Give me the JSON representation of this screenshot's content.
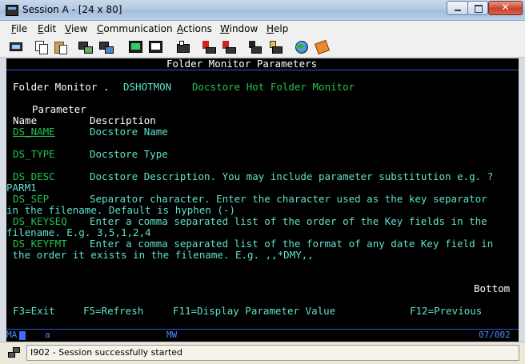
{
  "window": {
    "title": "Session A - [24 x 80]"
  },
  "menu": [
    "File",
    "Edit",
    "View",
    "Communication",
    "Actions",
    "Window",
    "Help"
  ],
  "toolbar_icons": [
    "print-screen-icon",
    "copy-icon",
    "paste-icon",
    "send-icon",
    "receive-icon",
    "display-icon",
    "keypad-icon",
    "record-macro-icon",
    "play-macro-icon",
    "stop-macro-icon",
    "run-icon",
    "settings-icon",
    "globe-icon",
    "help-icon"
  ],
  "screen": {
    "heading": "Folder Monitor Parameters",
    "folder_monitor_label": "Folder Monitor .",
    "folder_monitor_value": "DSHOTMON",
    "folder_monitor_desc": "Docstore Hot Folder Monitor",
    "param_header": "Parameter",
    "col_name": "Name",
    "col_desc": "Description",
    "rows": [
      {
        "name": "DS_NAME",
        "desc": "Docstore Name",
        "cont": ""
      },
      {
        "name": "DS_TYPE",
        "desc": "Docstore Type",
        "cont": ""
      },
      {
        "name": "DS_DESC",
        "desc": "Docstore Description. You may include parameter substitution e.g. ?",
        "cont": "PARM1"
      },
      {
        "name": "DS_SEP",
        "desc": "Separator character. Enter the character used as the key separator",
        "cont": "in the filename. Default is hyphen (-)"
      },
      {
        "name": "DS_KEYSEQ",
        "desc": "Enter a comma separated list of the order of the Key fields in the",
        "cont": "filename. E.g. 3,5,1,2,4"
      },
      {
        "name": "DS_KEYFMT",
        "desc": "Enter a comma separated list of the format of any date Key field in",
        "cont": " the order it exists in the filename. E.g. ,,*DMY,,"
      }
    ],
    "bottom": "Bottom",
    "fkeys": [
      "F3=Exit",
      "F5=Refresh",
      "F11=Display Parameter Value",
      "F12=Previous"
    ],
    "oia": {
      "left": "MA",
      "mode": "a",
      "mw": "MW",
      "cursor": "07/002"
    }
  },
  "status": {
    "message": "I902 - Session successfully started"
  }
}
